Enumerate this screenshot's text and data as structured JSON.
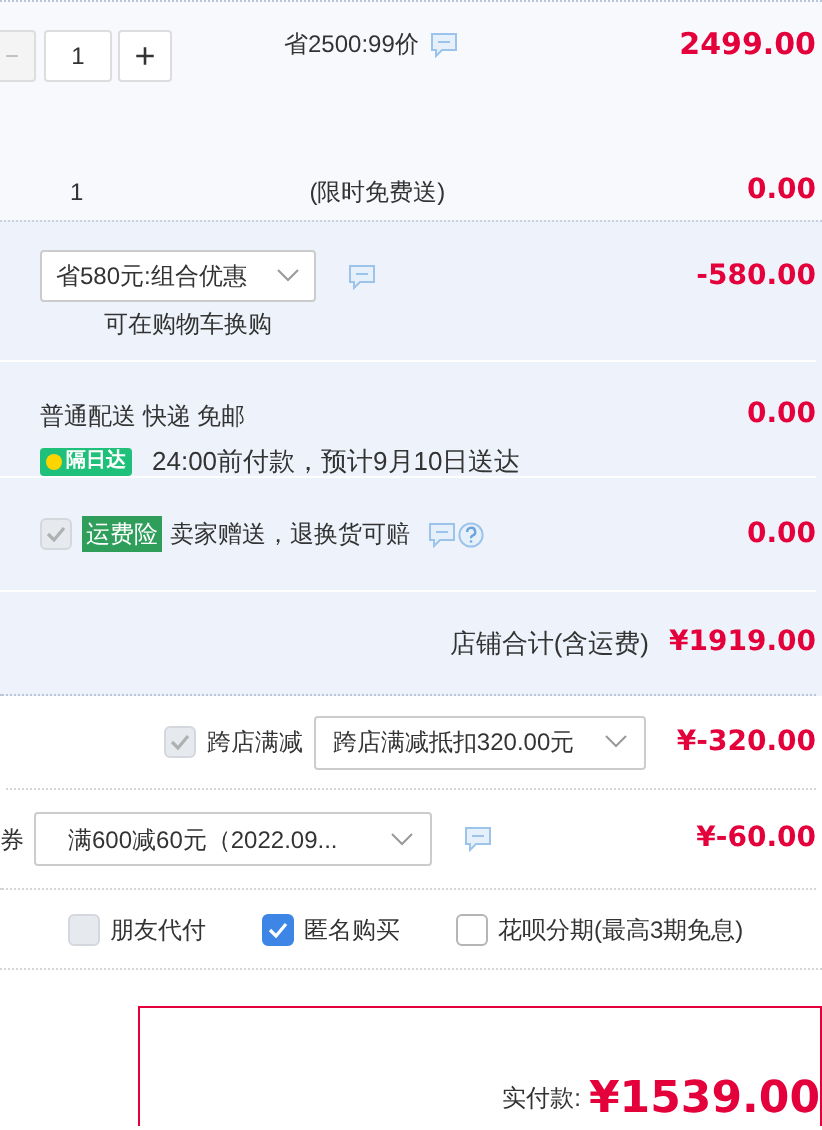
{
  "item": {
    "quantity": "1",
    "minus": "−",
    "plus": "+",
    "promo": "省2500:99价",
    "price": "2499.00"
  },
  "gift": {
    "quantity": "1",
    "label": "(限时免费送)",
    "price": "0.00"
  },
  "combo": {
    "select": "省580元:组合优惠",
    "note": "可在购物车换购",
    "price": "-580.00"
  },
  "shipping": {
    "method": "普通配送 快递 免邮",
    "badge": "隔日达",
    "note": "24:00前付款，预计9月10日送达",
    "price": "0.00"
  },
  "insurance": {
    "checked": true,
    "disabled": true,
    "badge": "运费险",
    "text": "卖家赠送，退换货可赔",
    "price": "0.00"
  },
  "store_total": {
    "label": "店铺合计(含运费)",
    "amount": "¥1919.00"
  },
  "cross_store": {
    "checked": true,
    "disabled": true,
    "label": "跨店满减",
    "select": "跨店满减抵扣320.00元",
    "amount": "¥-320.00"
  },
  "coupon": {
    "label": "券",
    "select": "满600减60元（2022.09...",
    "amount": "¥-60.00"
  },
  "options": [
    {
      "label": "朋友代付",
      "checked": false,
      "disabled": true
    },
    {
      "label": "匿名购买",
      "checked": true,
      "disabled": false
    },
    {
      "label": "花呗分期(最高3期免息)",
      "checked": false,
      "disabled": false
    }
  ],
  "payment": {
    "label": "实付款:",
    "amount": "¥1539.00"
  }
}
